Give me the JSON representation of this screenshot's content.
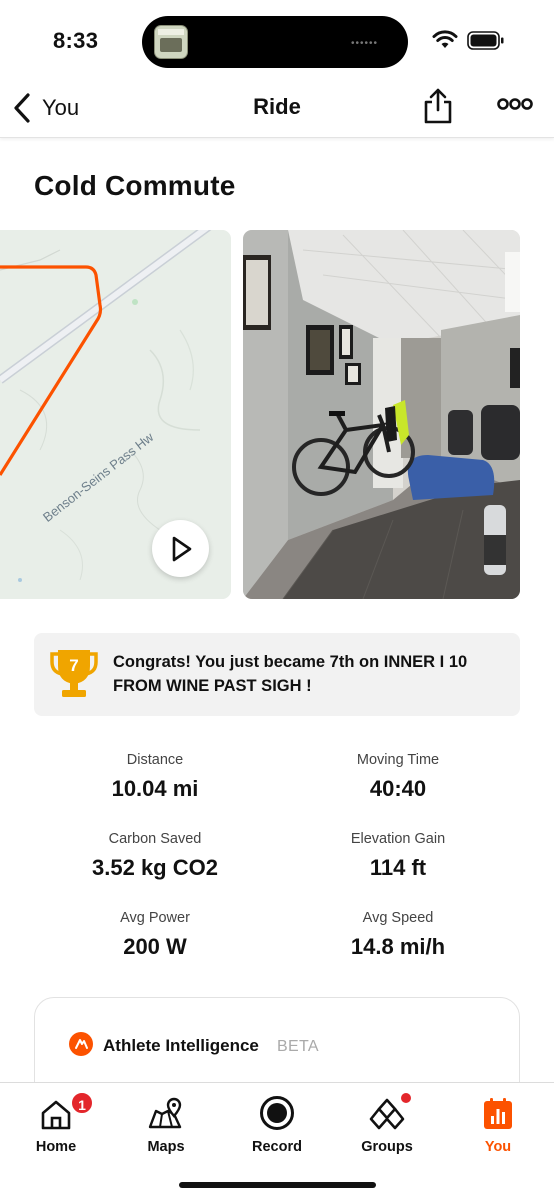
{
  "status_bar": {
    "time": "8:33"
  },
  "nav": {
    "back_label": "You",
    "title": "Ride"
  },
  "activity": {
    "title": "Cold Commute",
    "map_road_label": "Benson-Seins Pass Hw",
    "achievement": {
      "rank": "7",
      "text": "Congrats! You just became 7th on INNER I 10 FROM WINE PAST SIGH !"
    },
    "stats": [
      {
        "label": "Distance",
        "value": "10.04 mi"
      },
      {
        "label": "Moving Time",
        "value": "40:40"
      },
      {
        "label": "Carbon Saved",
        "value": "3.52 kg CO2"
      },
      {
        "label": "Elevation Gain",
        "value": "114 ft"
      },
      {
        "label": "Avg Power",
        "value": "200 W"
      },
      {
        "label": "Avg Speed",
        "value": "14.8 mi/h"
      }
    ]
  },
  "athlete_intelligence": {
    "title": "Athlete Intelligence",
    "badge": "BETA"
  },
  "tabs": [
    {
      "label": "Home",
      "icon": "home-icon",
      "badge": "1"
    },
    {
      "label": "Maps",
      "icon": "maps-icon"
    },
    {
      "label": "Record",
      "icon": "record-icon"
    },
    {
      "label": "Groups",
      "icon": "groups-icon"
    },
    {
      "label": "You",
      "icon": "you-icon",
      "active": true
    }
  ],
  "colors": {
    "accent": "#fc5200",
    "trophy": "#f0a500",
    "badge": "#e3262b"
  }
}
